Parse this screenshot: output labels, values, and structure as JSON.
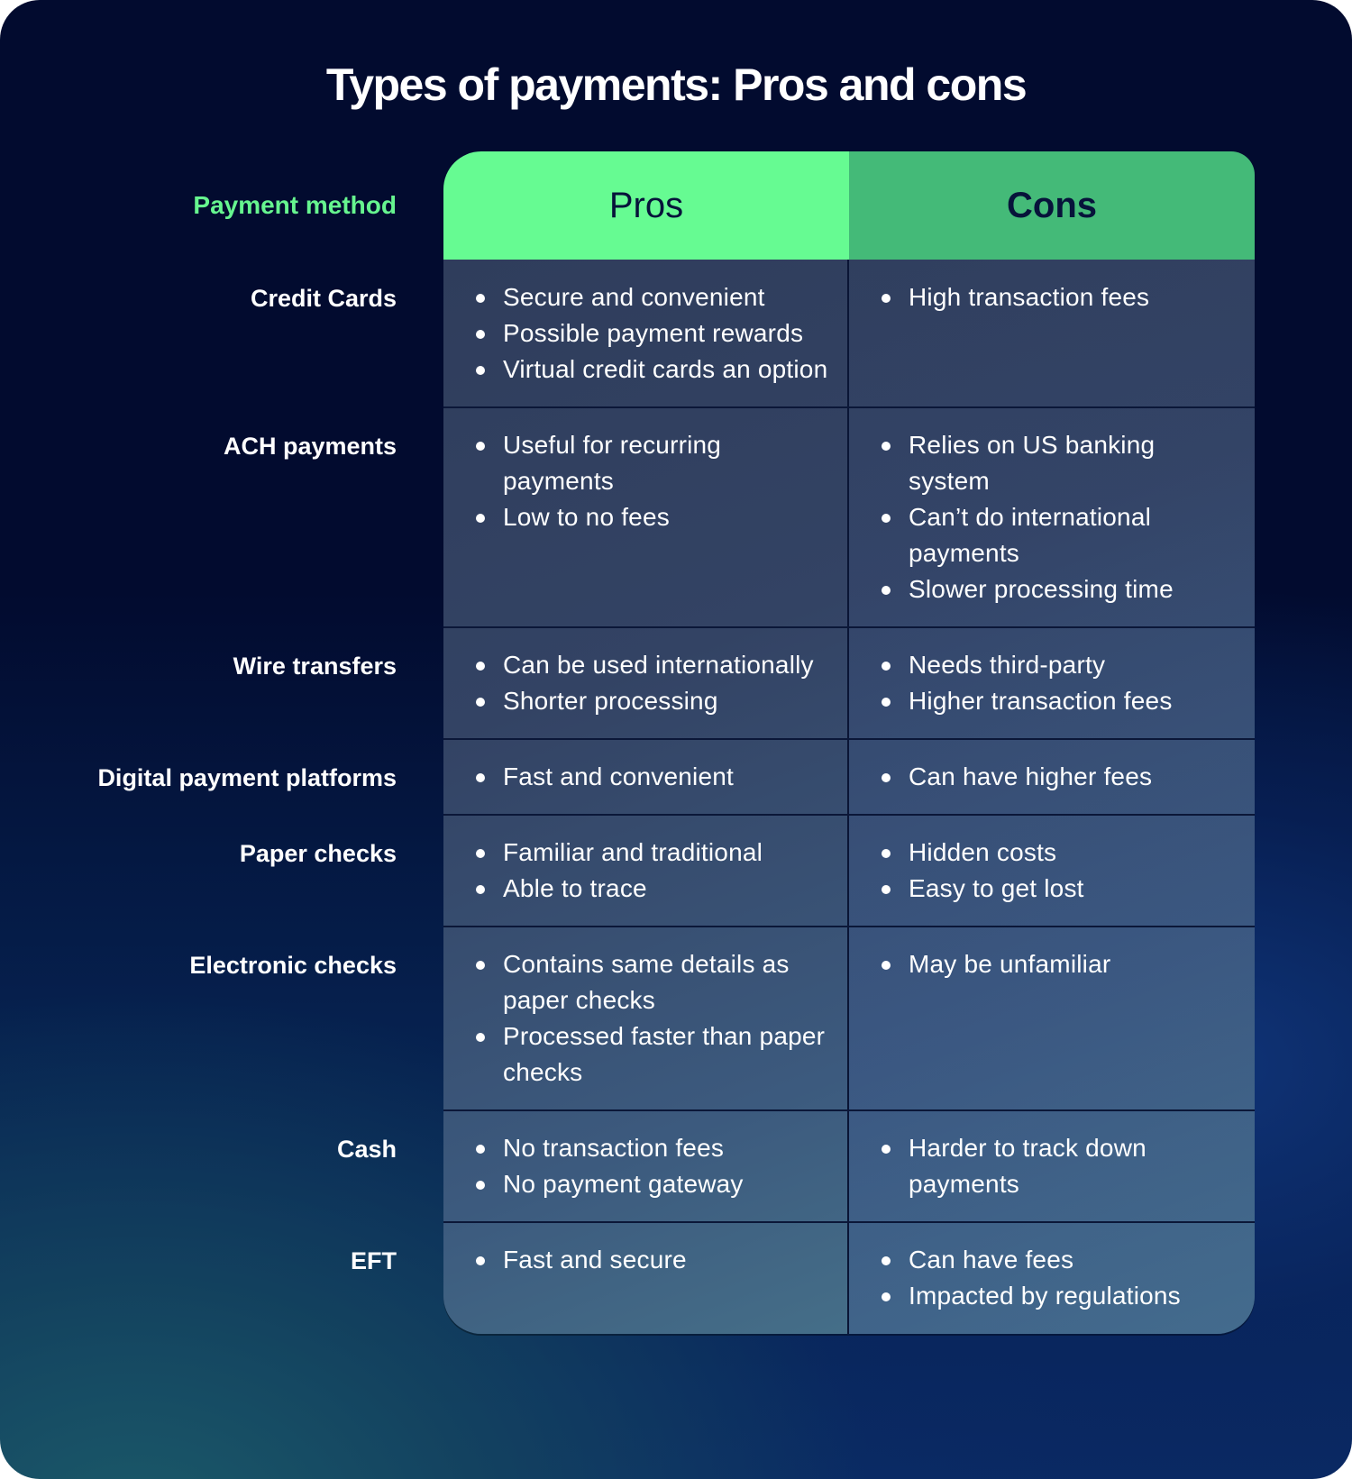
{
  "title": "Types of payments: Pros and cons",
  "colors": {
    "background_top": "#020b2f",
    "accent_green": "#66f58f",
    "pros_header": "#66fb92",
    "cons_header": "#44ba78",
    "header_text": "#07133a",
    "cell_bg": "#334364"
  },
  "table": {
    "headers": {
      "method": "Payment method",
      "pros": "Pros",
      "cons": "Cons"
    },
    "rows": [
      {
        "method": "Credit Cards",
        "pros": [
          "Secure and convenient",
          "Possible payment rewards",
          "Virtual credit cards an option"
        ],
        "cons": [
          "High transaction fees"
        ]
      },
      {
        "method": "ACH payments",
        "pros": [
          "Useful for recurring payments",
          "Low to no fees"
        ],
        "cons": [
          "Relies on US banking system",
          "Can’t do international payments",
          "Slower processing time"
        ]
      },
      {
        "method": "Wire transfers",
        "pros": [
          "Can be used internationally",
          "Shorter processing"
        ],
        "cons": [
          "Needs third-party",
          "Higher transaction fees"
        ]
      },
      {
        "method": "Digital payment platforms",
        "pros": [
          "Fast and convenient"
        ],
        "cons": [
          "Can have higher fees"
        ]
      },
      {
        "method": "Paper checks",
        "pros": [
          "Familiar and traditional",
          "Able to trace"
        ],
        "cons": [
          "Hidden costs",
          "Easy to get lost"
        ]
      },
      {
        "method": "Electronic checks",
        "pros": [
          "Contains same details as paper checks",
          "Processed faster than paper checks"
        ],
        "cons": [
          "May be unfamiliar"
        ]
      },
      {
        "method": "Cash",
        "pros": [
          "No transaction fees",
          "No payment gateway"
        ],
        "cons": [
          "Harder to track down payments"
        ]
      },
      {
        "method": "EFT",
        "pros": [
          "Fast and secure"
        ],
        "cons": [
          "Can have fees",
          "Impacted by regulations"
        ]
      }
    ]
  }
}
